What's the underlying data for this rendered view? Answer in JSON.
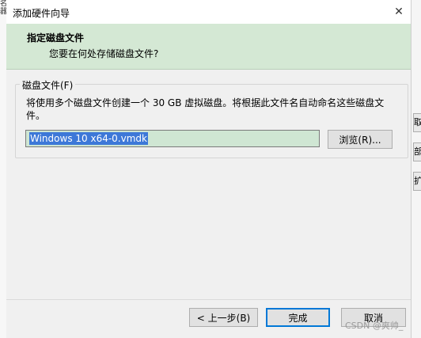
{
  "window": {
    "title": "添加硬件向导",
    "close_glyph": "✕"
  },
  "header": {
    "title": "指定磁盘文件",
    "subtitle": "您要在何处存储磁盘文件?"
  },
  "disk_file": {
    "group_label": "磁盘文件(F)",
    "description": "将使用多个磁盘文件创建一个 30 GB 虚拟磁盘。将根据此文件名自动命名这些磁盘文件。",
    "file_name": "Windows 10 x64-0.vmdk",
    "browse_label": "浏览(R)..."
  },
  "footer": {
    "back_label": "< 上一步(B)",
    "finish_label": "完成",
    "cancel_label": "取消"
  },
  "background": {
    "left_chars": [
      "名",
      "器"
    ],
    "right_buttons": [
      "取",
      "部",
      "扩"
    ]
  },
  "watermark": "CSDN @爽帅_",
  "colors": {
    "header_bg": "#d4e8d4",
    "input_bg": "#cfe6d3",
    "selection": "#3d78d8",
    "default_button_border": "#0078d7"
  }
}
